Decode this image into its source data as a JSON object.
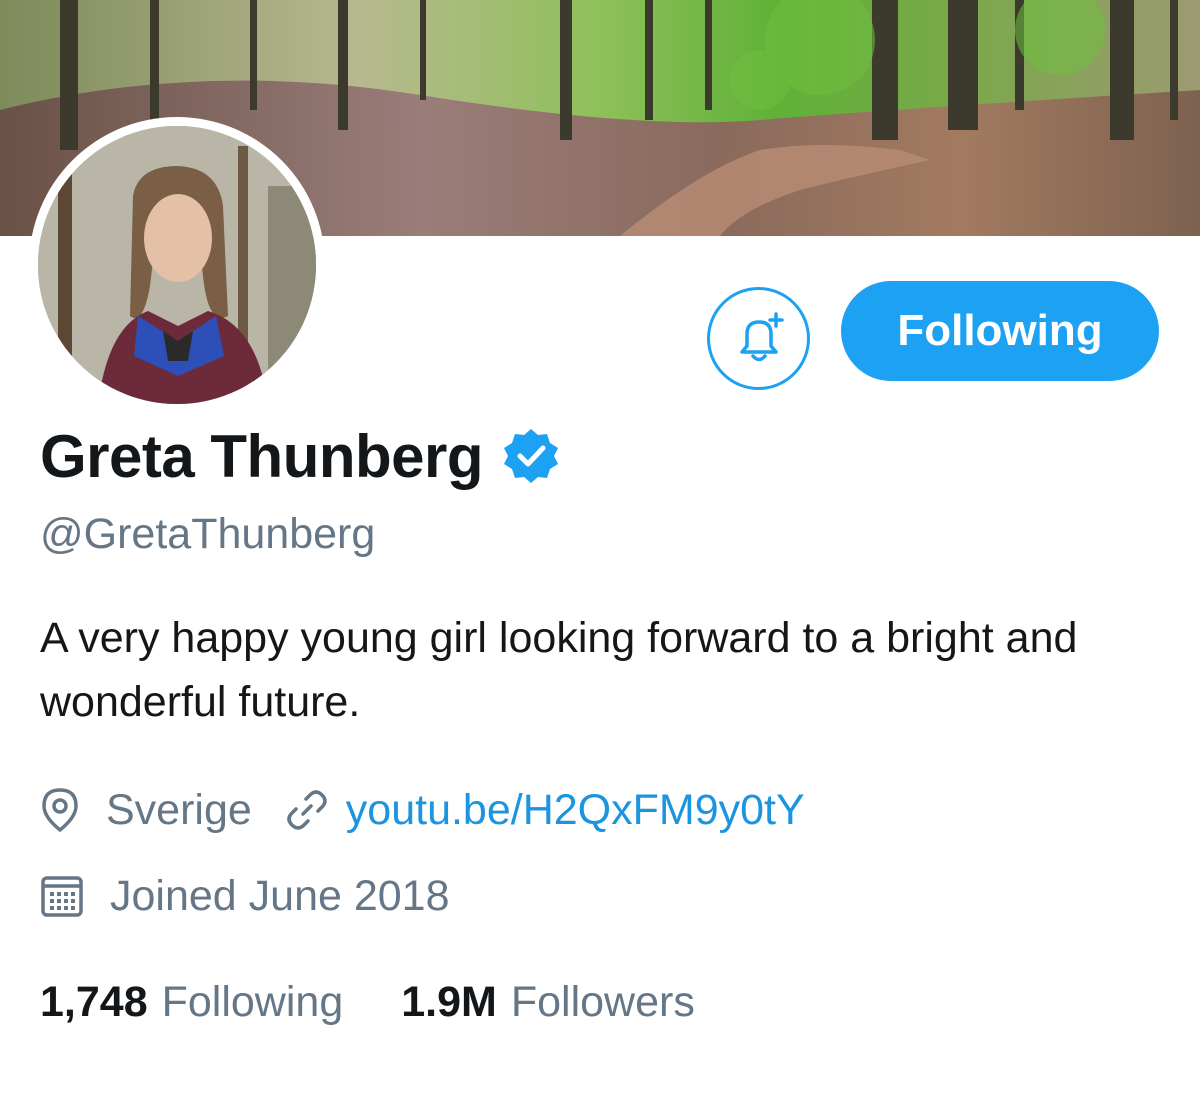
{
  "profile": {
    "display_name": "Greta Thunberg",
    "handle": "@GretaThunberg",
    "verified": true,
    "bio": "A very happy young girl looking forward to a bright and wonderful future.",
    "location": "Sverige",
    "website": "youtu.be/H2QxFM9y0tY",
    "joined": "Joined June 2018"
  },
  "actions": {
    "follow_button_label": "Following",
    "notifications_icon": "bell-plus-icon"
  },
  "stats": {
    "following_count": "1,748",
    "following_label": "Following",
    "followers_count": "1.9M",
    "followers_label": "Followers"
  },
  "icons": {
    "location": "location-pin-icon",
    "link": "link-icon",
    "calendar": "calendar-icon",
    "verified": "verified-badge-icon"
  },
  "colors": {
    "accent": "#1da1f2",
    "link": "#1b95e0",
    "text_primary": "#14171a",
    "text_secondary": "#657786"
  }
}
